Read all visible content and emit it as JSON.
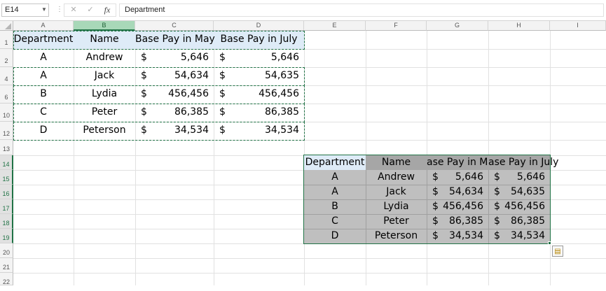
{
  "formula_bar": {
    "name_box": "E14",
    "grip": "⋮",
    "cancel_glyph": "✕",
    "enter_glyph": "✓",
    "fx_label": "fx",
    "formula_value": "Department"
  },
  "columns": [
    "A",
    "B",
    "C",
    "D",
    "E",
    "F",
    "G",
    "H",
    "I"
  ],
  "rows": [
    "1",
    "2",
    "4",
    "6",
    "10",
    "12",
    "13",
    "14",
    "15",
    "16",
    "17",
    "18",
    "19",
    "20",
    "21",
    "22"
  ],
  "source_table": {
    "headers": [
      "Department",
      "Name",
      "Base Pay in May",
      "Base Pay in July"
    ],
    "currency_symbol": "$",
    "rows": [
      {
        "department": "A",
        "name": "Andrew",
        "may": "5,646",
        "july": "5,646"
      },
      {
        "department": "A",
        "name": "Jack",
        "may": "54,634",
        "july": "54,635"
      },
      {
        "department": "B",
        "name": "Lydia",
        "may": "456,456",
        "july": "456,456"
      },
      {
        "department": "C",
        "name": "Peter",
        "may": "86,385",
        "july": "86,385"
      },
      {
        "department": "D",
        "name": "Peterson",
        "may": "34,534",
        "july": "34,534"
      }
    ]
  },
  "pasted_table": {
    "headers": [
      "Department",
      "Name",
      "ase Pay in Ma",
      "ase Pay in July"
    ],
    "currency_symbol": "$",
    "rows": [
      {
        "department": "A",
        "name": "Andrew",
        "may": "5,646",
        "july": "5,646"
      },
      {
        "department": "A",
        "name": "Jack",
        "may": "54,634",
        "july": "54,635"
      },
      {
        "department": "B",
        "name": "Lydia",
        "may": "456,456",
        "july": "456,456"
      },
      {
        "department": "C",
        "name": "Peter",
        "may": "86,385",
        "july": "86,385"
      },
      {
        "department": "D",
        "name": "Peterson",
        "may": "34,534",
        "july": "34,534"
      }
    ]
  },
  "colors": {
    "accent": "#217346",
    "source_header_fill": "#deebf7",
    "pasted_header_fill": "#a6a6a6",
    "pasted_body_fill": "#bfbfbf"
  },
  "icons": {
    "paste_options": "clipboard-icon"
  }
}
